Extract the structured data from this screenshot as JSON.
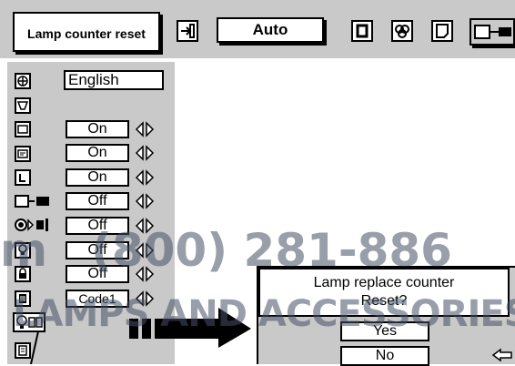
{
  "header": {
    "title": "Lamp counter reset",
    "mode_value": "Auto"
  },
  "menu": {
    "language": "English",
    "rows": [
      {
        "icon": "monitor-icon",
        "value": "On"
      },
      {
        "icon": "display-icon",
        "value": "On"
      },
      {
        "icon": "logo-icon",
        "value": "On"
      },
      {
        "icon": "lamp-mode-icon",
        "value": "Off"
      },
      {
        "icon": "power-icon",
        "value": "Off"
      },
      {
        "icon": "bulb-icon",
        "value": "Off"
      },
      {
        "icon": "lock-icon",
        "value": "Off"
      },
      {
        "icon": "pin-code-icon",
        "value": "Code1"
      }
    ]
  },
  "dialog": {
    "line1": "Lamp replace counter",
    "line2": "Reset?",
    "yes": "Yes",
    "no": "No"
  },
  "watermark": {
    "phone": "(800) 281-886",
    "brand": "LAMPS AND ACCESSORIES",
    "prefix": "m"
  },
  "colors": {
    "panel": "#c9c9c9",
    "text": "#000000",
    "watermark": "#505a6e"
  }
}
